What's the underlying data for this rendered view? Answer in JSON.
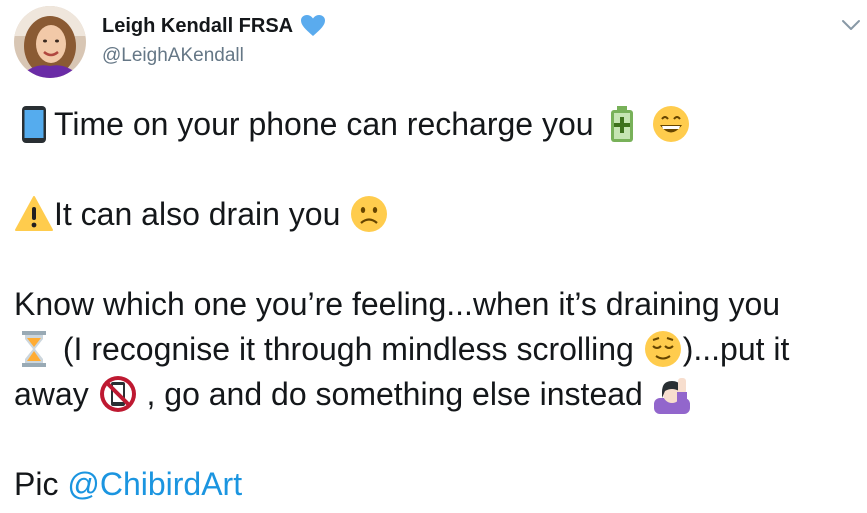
{
  "author": {
    "display_name": "Leigh Kendall FRSA",
    "handle": "@LeighAKendall",
    "verified_icon": "blue-heart-icon",
    "accent_color": "#5aabee"
  },
  "tweet": {
    "line1": {
      "text": "Time on your phone can recharge you",
      "emoji_before": "mobile-phone-icon",
      "emoji_after": [
        "battery-plus-icon",
        "grinning-face-icon"
      ]
    },
    "line2": {
      "text": "It can also drain you",
      "emoji_before": "warning-icon",
      "emoji_after": [
        "frowning-face-icon"
      ]
    },
    "line3": {
      "text": "Know which one you’re feeling...when it’s draining you"
    },
    "line4": {
      "text_a": "(I recognise it through mindless scrolling",
      "text_b": ")...put it",
      "emoji": [
        "hourglass-icon",
        "relieved-face-icon"
      ]
    },
    "line5": {
      "text_a": "away",
      "text_b": ", go and do something else instead",
      "emoji": [
        "no-mobile-phones-icon",
        "person-raising-hand-icon"
      ]
    },
    "line6": {
      "prefix": "Pic",
      "mention": "@ChibirdArt"
    }
  },
  "colors": {
    "mention": "#1b95e0",
    "handle": "#657786",
    "text": "#14171a"
  }
}
